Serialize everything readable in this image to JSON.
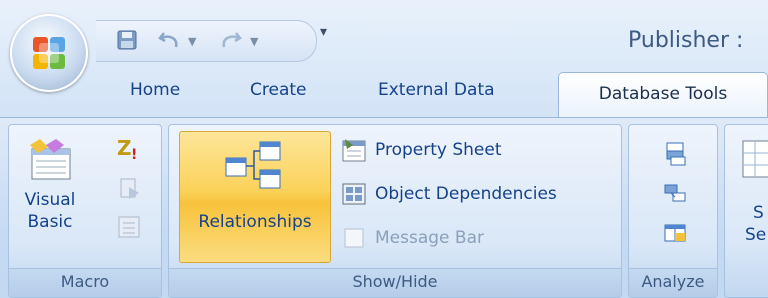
{
  "window": {
    "title": "Publisher : "
  },
  "quick_access": {
    "items": [
      "save-icon",
      "undo-icon",
      "redo-icon",
      "customize-qat-icon"
    ]
  },
  "tabs": [
    {
      "label": "Home",
      "active": false
    },
    {
      "label": "Create",
      "active": false
    },
    {
      "label": "External Data",
      "active": false
    },
    {
      "label": "Database Tools",
      "active": true
    }
  ],
  "ribbon": {
    "macro": {
      "label": "Macro",
      "visual_basic": {
        "line1": "Visual",
        "line2": "Basic"
      }
    },
    "show_hide": {
      "label": "Show/Hide",
      "relationships": "Relationships",
      "property_sheet": "Property Sheet",
      "object_dependencies": "Object Dependencies",
      "message_bar": "Message Bar"
    },
    "analyze": {
      "label": "Analyze"
    },
    "next_group": {
      "line1": "S",
      "line2": "Se"
    }
  },
  "colors": {
    "accent": "#15428b",
    "highlight": "#fbd25a",
    "ribbon": "#c6daf2"
  }
}
